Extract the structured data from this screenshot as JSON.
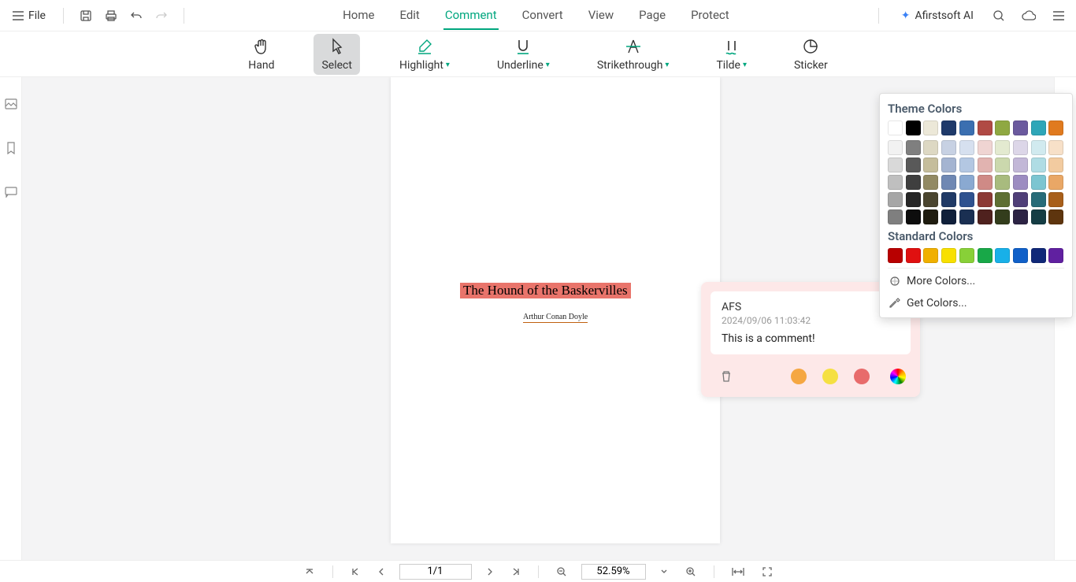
{
  "top": {
    "file_label": "File",
    "menu": [
      "Home",
      "Edit",
      "Comment",
      "Convert",
      "View",
      "Page",
      "Protect"
    ],
    "active_menu_index": 2,
    "ai_label": "Afirstsoft AI"
  },
  "tools": {
    "hand": "Hand",
    "select": "Select",
    "highlight": "Highlight",
    "underline": "Underline",
    "strikethrough": "Strikethrough",
    "tilde": "Tilde",
    "sticker": "Sticker"
  },
  "document": {
    "title": "The Hound of the Baskervilles",
    "author": "Arthur Conan Doyle"
  },
  "comment": {
    "author": "AFS",
    "timestamp": "2024/09/06 11:03:42",
    "body": "This is a comment!",
    "quick_colors": [
      "#f5a742",
      "#f5e042",
      "#e86b6b"
    ]
  },
  "color_panel": {
    "theme_heading": "Theme Colors",
    "standard_heading": "Standard Colors",
    "more_label": "More Colors...",
    "get_label": "Get Colors...",
    "theme_row1": [
      "#ffffff",
      "#000000",
      "#ece8d8",
      "#1f3a6a",
      "#3b6fb0",
      "#b04a44",
      "#8fa842",
      "#6b5a9e",
      "#2fa6b8",
      "#e07a1f"
    ],
    "theme_shades": [
      [
        "#f2f2f2",
        "#7f7f7f",
        "#ddd8c3",
        "#c7d1e3",
        "#d6e0ef",
        "#efd4d2",
        "#e3ead0",
        "#dcd6e8",
        "#d1eaef",
        "#f7e0c8"
      ],
      [
        "#d9d9d9",
        "#595959",
        "#c5bd9b",
        "#a4b4d1",
        "#b3c7e2",
        "#e1b3b0",
        "#cbd8ad",
        "#c2b7d7",
        "#afdce4",
        "#f2cba0"
      ],
      [
        "#bfbfbf",
        "#3f3f3f",
        "#928a64",
        "#6f88b3",
        "#8aa9d1",
        "#cf8a86",
        "#a8bb7e",
        "#9c8cc1",
        "#7cc5d1",
        "#e9a766"
      ],
      [
        "#a6a6a6",
        "#262626",
        "#4a452f",
        "#203a66",
        "#2f528f",
        "#8c3a35",
        "#5e6f33",
        "#4f3f78",
        "#276b78",
        "#a85f1a"
      ],
      [
        "#7f7f7f",
        "#0d0d0d",
        "#1f1c10",
        "#10203a",
        "#1a2f52",
        "#4f211e",
        "#333d1c",
        "#2c2344",
        "#153d44",
        "#5e350e"
      ]
    ],
    "standard": [
      "#b80000",
      "#e01010",
      "#f0b000",
      "#f8e000",
      "#88d038",
      "#18a848",
      "#18b0e8",
      "#1060c8",
      "#102878",
      "#6020a0"
    ]
  },
  "status": {
    "page_display": "1/1",
    "zoom_display": "52.59%"
  }
}
